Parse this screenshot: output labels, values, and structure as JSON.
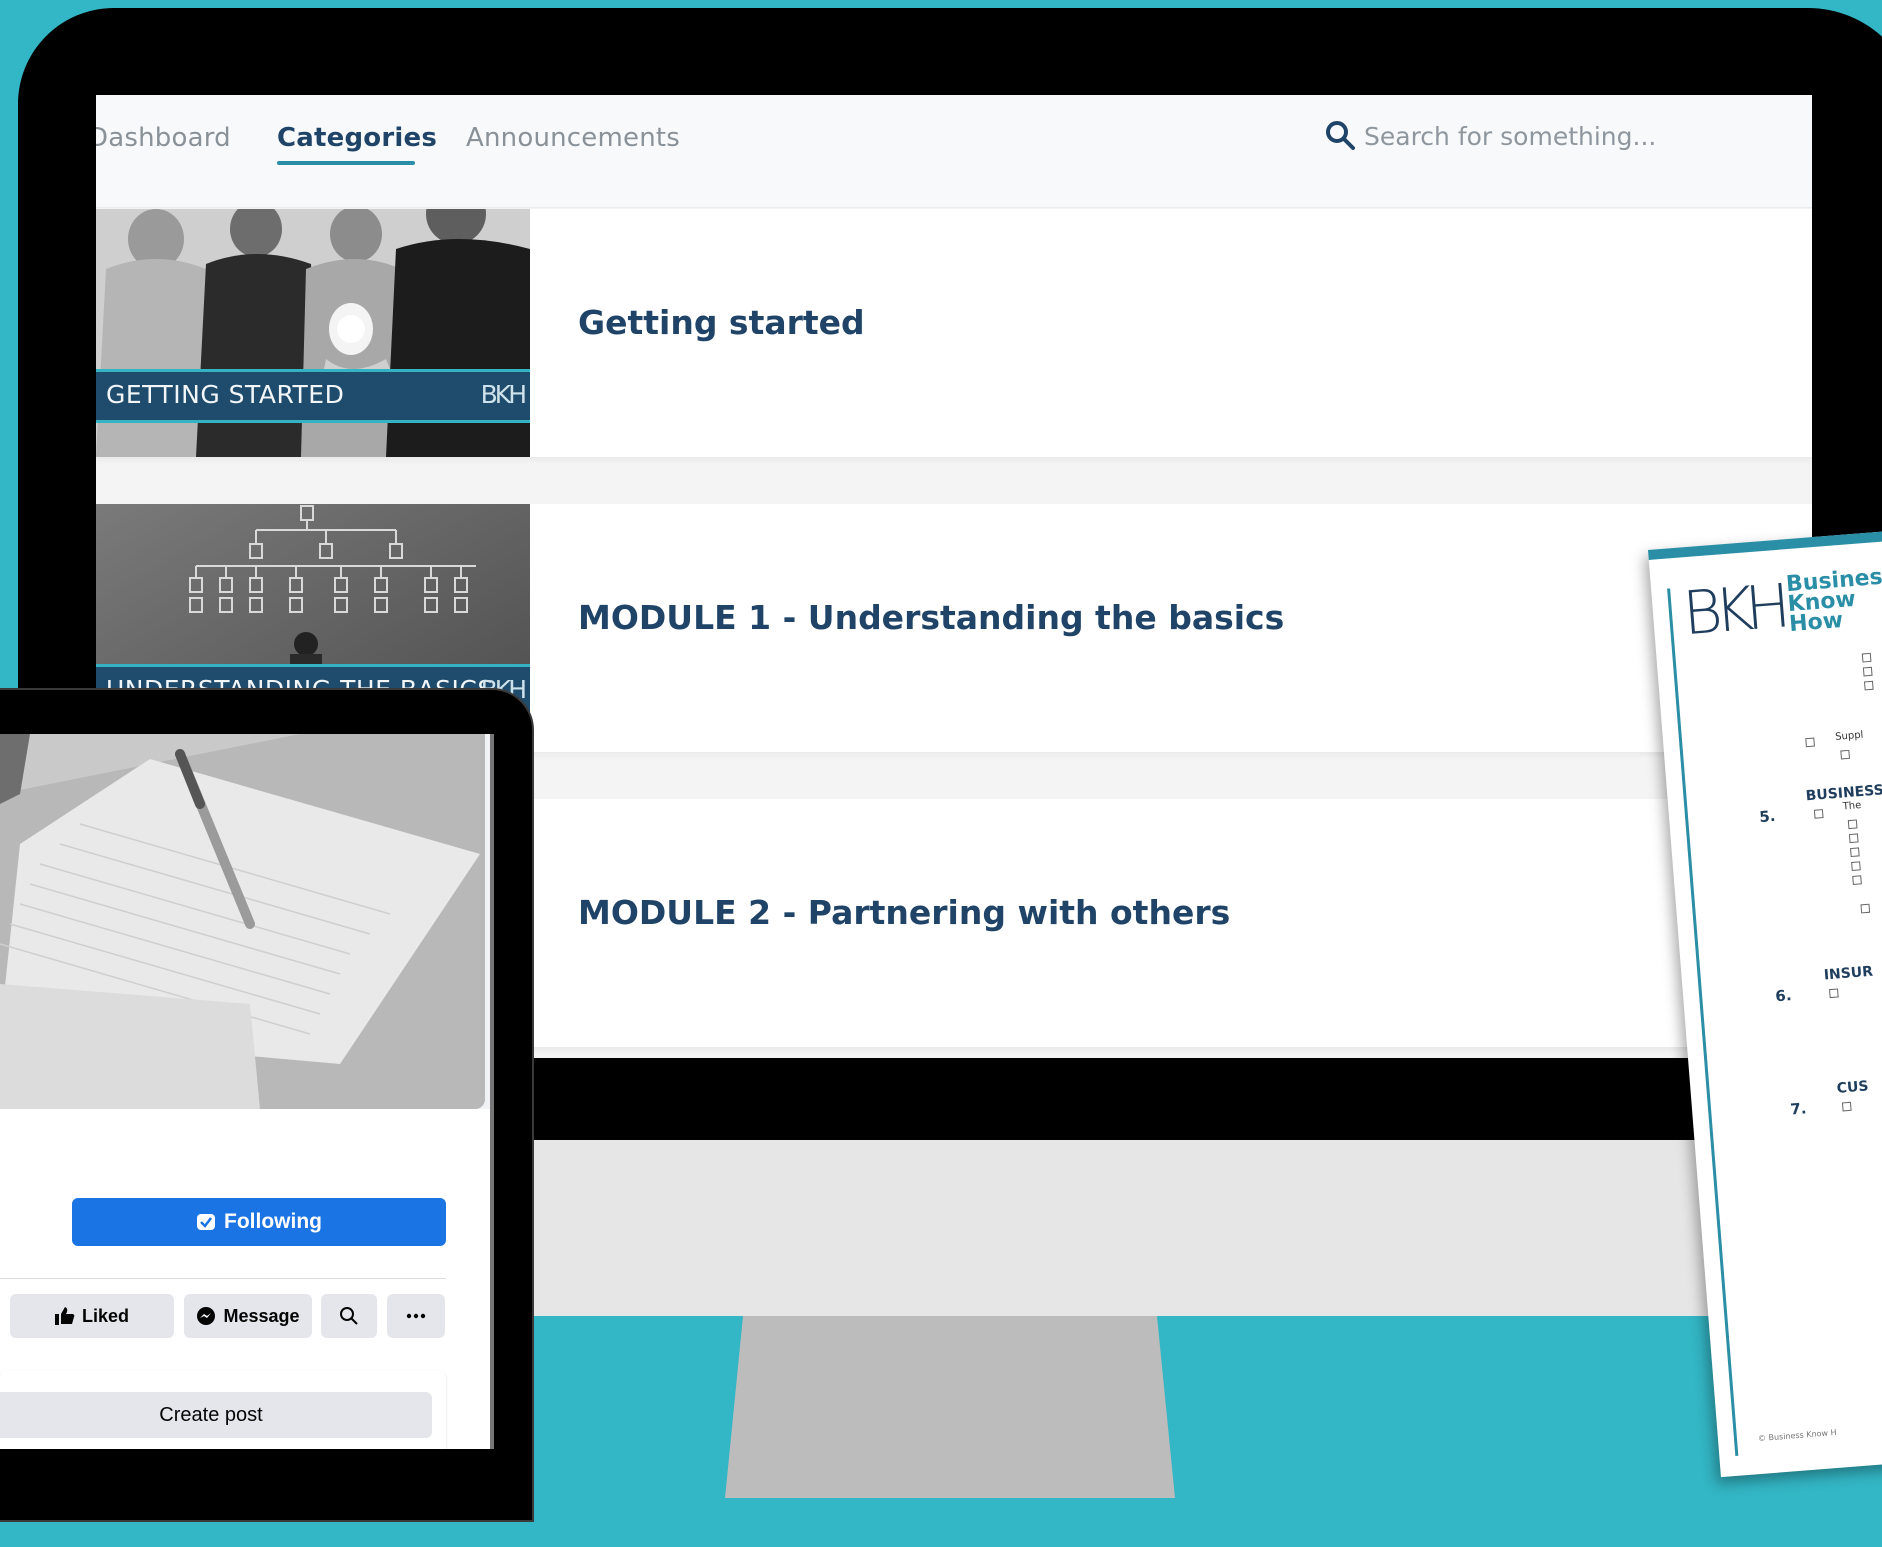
{
  "nav": {
    "tabs": [
      {
        "label": "Dashboard",
        "active": false
      },
      {
        "label": "Categories",
        "active": true
      },
      {
        "label": "Announcements",
        "active": false
      }
    ],
    "search_placeholder": "Search for something..."
  },
  "categories": [
    {
      "title": "Getting started",
      "thumb_label": "GETTING STARTED",
      "thumb_logo": "BKH"
    },
    {
      "title": "MODULE 1 - Understanding the basics",
      "thumb_label": "UNDERSTANDING THE BASICS",
      "thumb_logo": "BKH"
    },
    {
      "title": "MODULE 2 - Partnering with others"
    }
  ],
  "tablet": {
    "following_label": "Following",
    "liked_label": "Liked",
    "message_label": "Message",
    "create_post_label": "Create post"
  },
  "document": {
    "logo_mark": "BKH",
    "logo_lines": [
      "Business",
      "Know",
      "How"
    ],
    "sections": [
      {
        "number": "5.",
        "heading": "BUSINESS"
      },
      {
        "number": "6.",
        "heading": "INSUR"
      },
      {
        "number": "7.",
        "heading": "CUS"
      }
    ],
    "snippet_supp": "Suppl",
    "snippet_the": "The",
    "footer": "© Business Know H"
  },
  "colors": {
    "background": "#33b6c5",
    "nav_active": "#1f4467",
    "accent": "#2a8fa6",
    "follow_button": "#1b74e4"
  }
}
